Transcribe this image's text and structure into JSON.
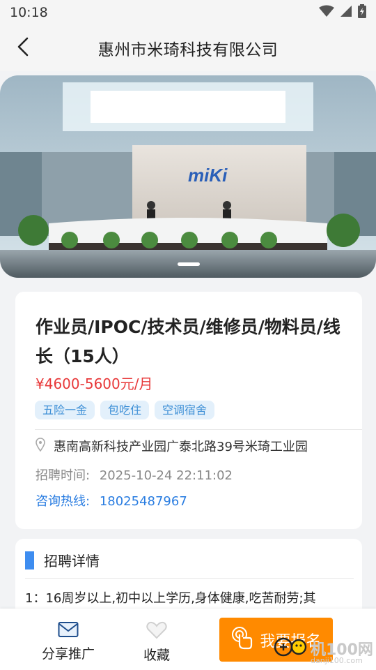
{
  "status_bar": {
    "time": "10:18"
  },
  "header": {
    "title": "惠州市米琦科技有限公司"
  },
  "banner": {
    "logo_text": "miKi"
  },
  "job": {
    "title": "作业员/IPOC/技术员/维修员/物料员/线长（15人）",
    "salary": "¥4600-5600元/月",
    "tags": [
      "五险一金",
      "包吃住",
      "空调宿舍"
    ],
    "address": "惠南高新科技产业园广泰北路39号米琦工业园",
    "time_label": "招聘时间:",
    "time_value": "2025-10-24 22:11:02",
    "hotline_label": "咨询热线:",
    "hotline_value": "18025487967"
  },
  "detail": {
    "title": "招聘详情",
    "text": "1：16周岁以上,初中以上学历,身体健康,吃苦耐劳;其"
  },
  "bottom": {
    "share_label": "分享推广",
    "fav_label": "收藏",
    "signup_label": "我要报名"
  },
  "watermark": {
    "text": "机100网",
    "url": "danji100.com"
  },
  "colors": {
    "accent": "#3e8df0",
    "salary": "#e8393a",
    "signup": "#ff8a00",
    "link": "#2a7de1"
  }
}
